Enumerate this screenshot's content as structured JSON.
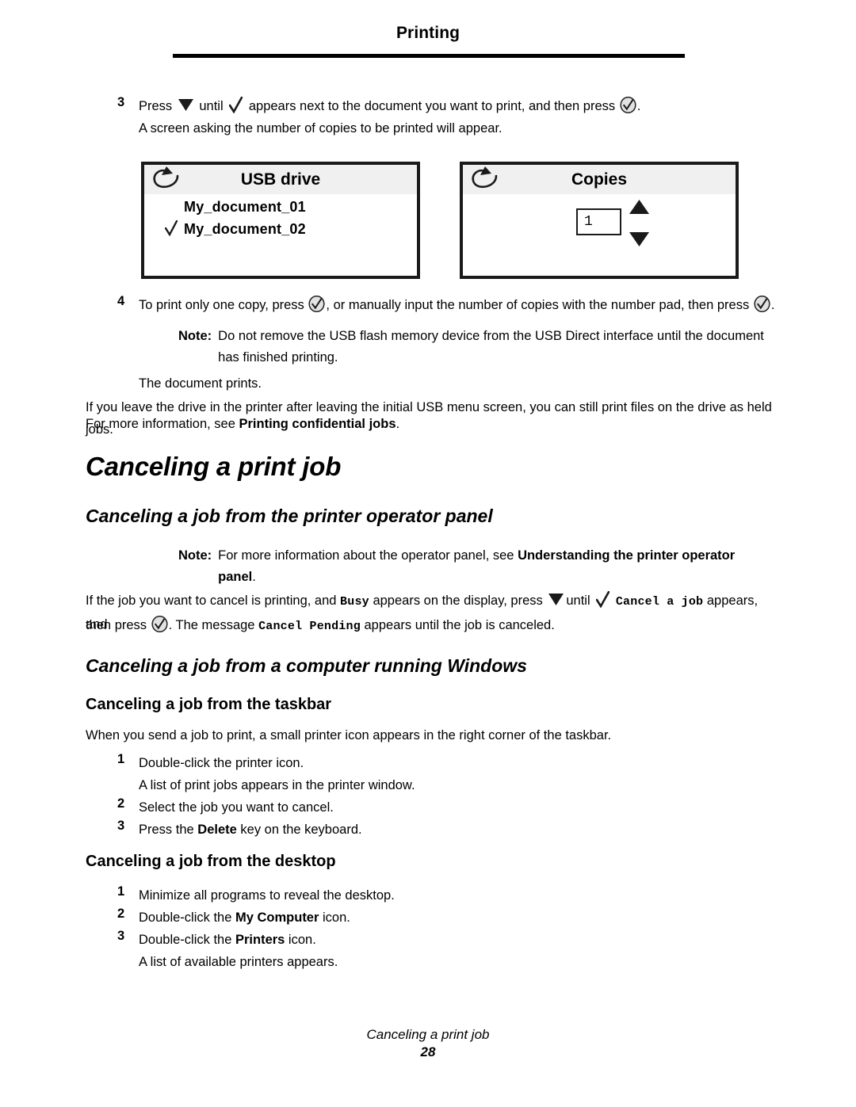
{
  "header": {
    "title": "Printing"
  },
  "steps_top": {
    "step3": {
      "num": "3",
      "text_1": "Press",
      "text_2": "until",
      "text_3": "appears next to the document you want to print, and then press",
      "text_4": ".",
      "sub": "A screen asking the number of copies to be printed will appear."
    },
    "step4": {
      "num": "4",
      "text_1": "To print only one copy, press",
      "text_2": ", or manually input the number of copies with the number pad, then press",
      "text_3": "."
    },
    "note": {
      "label": "Note:",
      "text": "Do not remove the USB flash memory device from the USB Direct interface until the document has finished printing."
    },
    "document_prints": "The document prints."
  },
  "usb_panel": {
    "back_icon": "back-arrow-icon",
    "title": "USB drive",
    "files": [
      {
        "name": "My_document_01",
        "selected": false
      },
      {
        "name": "My_document_02",
        "selected": true
      }
    ]
  },
  "copies_panel": {
    "back_icon": "back-arrow-icon",
    "title": "Copies",
    "value": "1",
    "up_icon": "increment-arrow-icon",
    "down_icon": "decrement-arrow-icon"
  },
  "held_jobs_paragraph": {
    "line1": "If you leave the drive in the printer after leaving the initial USB menu screen, you can still print files on the drive as held jobs.",
    "line2_pre": "For more information, see",
    "line2_bold": "Printing confidential jobs",
    "line2_post": "."
  },
  "canceling": {
    "h1": "Canceling a print job",
    "h2_operator_panel": "Canceling a job from the printer operator panel",
    "note": {
      "label": "Note:",
      "pre": "For more information about the operator panel, see",
      "bold": "Understanding the printer operator panel",
      "post": "."
    },
    "paragraph": {
      "p1": "If the job you want to cancel is printing, and",
      "busy": "Busy",
      "p2": "appears on the display, press",
      "p3": "until",
      "cancel_a_job": "Cancel a job",
      "p4": "appears, and",
      "p5": "then press",
      "p6": ". The message",
      "cancel_pending": "Cancel Pending",
      "p7": "appears until the job is canceled."
    },
    "h2_windows": "Canceling a job from a computer running Windows",
    "taskbar": {
      "h3": "Canceling a job from the taskbar",
      "intro": "When you send a job to print, a small printer icon appears in the right corner of the taskbar.",
      "steps": [
        {
          "num": "1",
          "text": "Double-click the printer icon."
        },
        {
          "num": "",
          "text": "A list of print jobs appears in the printer window."
        },
        {
          "num": "2",
          "text": "Select the job you want to cancel."
        },
        {
          "num": "3",
          "pre": "Press the ",
          "bold": "Delete",
          "post": " key on the keyboard."
        }
      ]
    },
    "desktop": {
      "h3": "Canceling a job from the desktop",
      "steps": [
        {
          "num": "1",
          "text": "Minimize all programs to reveal the desktop."
        },
        {
          "num": "2",
          "pre": "Double-click the ",
          "bold": "My Computer",
          "post": " icon."
        },
        {
          "num": "3",
          "pre": "Double-click the ",
          "bold": "Printers",
          "post": " icon."
        },
        {
          "num": "",
          "text": "A list of available printers appears."
        }
      ]
    }
  },
  "footer": {
    "title": "Canceling a print job",
    "page": "28"
  }
}
